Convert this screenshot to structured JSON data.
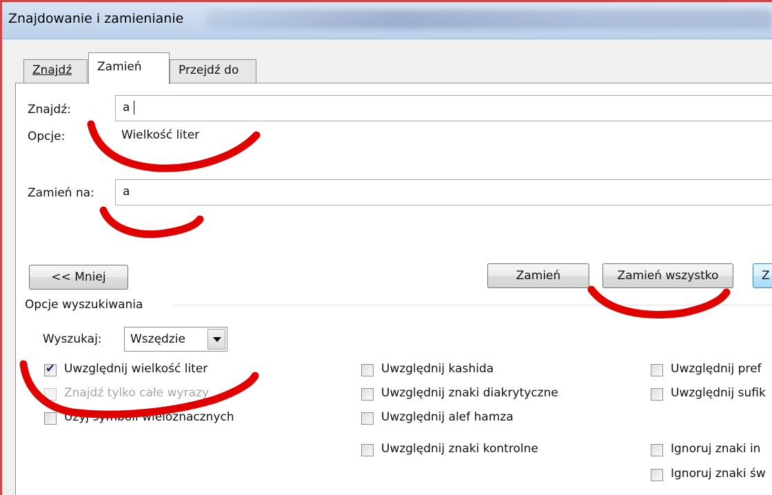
{
  "window": {
    "title": "Znajdowanie i zamienianie"
  },
  "tabs": [
    {
      "label": "Znajdź",
      "active": false
    },
    {
      "label": "Zamień",
      "active": true
    },
    {
      "label": "Przejdź do",
      "active": false
    }
  ],
  "find": {
    "label": "Znajdź:",
    "value": "a",
    "options_label": "Opcje:",
    "options_value": "Wielkość liter"
  },
  "replace": {
    "label": "Zamień na:",
    "value": "a"
  },
  "buttons": {
    "less": "<< Mniej",
    "replace": "Zamień",
    "replace_all": "Zamień wszystko",
    "find_next_partial": "Z"
  },
  "search_options": {
    "group_label": "Opcje wyszukiwania",
    "search_label": "Wyszukaj:",
    "search_value": "Wszędzie",
    "checkboxes": [
      {
        "label": "Uwzględnij wielkość liter",
        "checked": true,
        "enabled": true
      },
      {
        "label": "Znajdź tylko całe wyrazy",
        "checked": false,
        "enabled": false
      },
      {
        "label": "Użyj symboli wieloznacznych",
        "checked": false,
        "enabled": true
      },
      {
        "label": "Uwzględnij kashida",
        "checked": false,
        "enabled": true
      },
      {
        "label": "Uwzględnij znaki diakrytyczne",
        "checked": false,
        "enabled": true
      },
      {
        "label": "Uwzględnij alef hamza",
        "checked": false,
        "enabled": true
      },
      {
        "label": "Uwzględnij znaki kontrolne",
        "checked": false,
        "enabled": true
      },
      {
        "label": "Uwzględnij pref",
        "checked": false,
        "enabled": true
      },
      {
        "label": "Uwzględnij sufik",
        "checked": false,
        "enabled": true
      },
      {
        "label": "Ignoruj znaki in",
        "checked": false,
        "enabled": true
      },
      {
        "label": "Ignoruj znaki św",
        "checked": false,
        "enabled": true
      }
    ]
  },
  "annotation_color": "#e00000"
}
